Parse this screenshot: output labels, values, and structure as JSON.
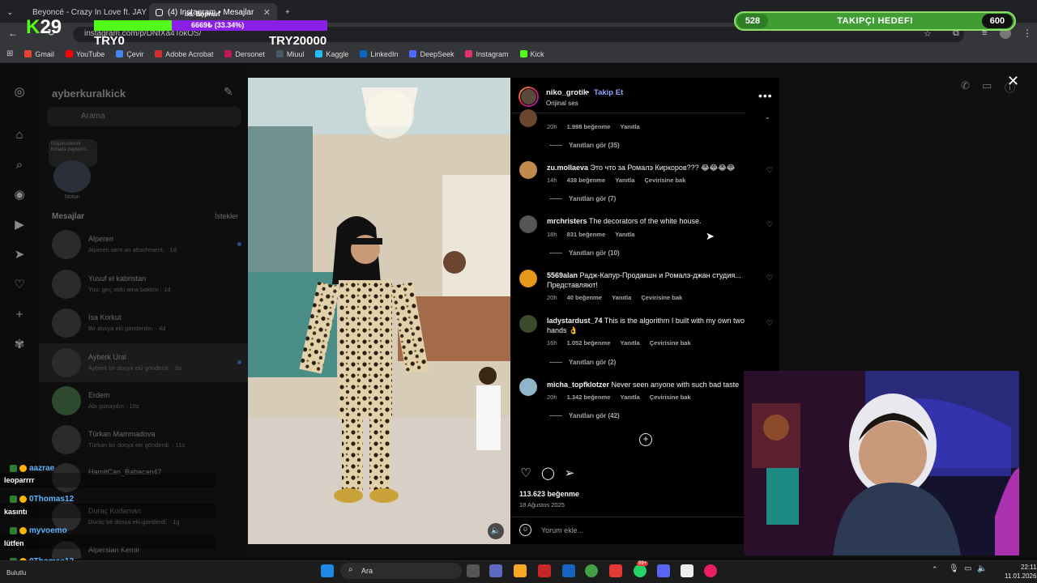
{
  "browser": {
    "tabs": [
      {
        "label": "Beyoncé - Crazy In Love ft. JAY",
        "active": false
      },
      {
        "label": "(4) Instagram • Mesajlar",
        "active": true
      }
    ],
    "url": "instagram.com/p/DNfXa4TokOS/",
    "bookmarks": [
      "Gmail",
      "YouTube",
      "Çevir",
      "Adobe Acrobat",
      "Dersonet",
      "Miuul",
      "Kaggle",
      "LinkedIn",
      "DeepSeek",
      "Instagram",
      "Kick"
    ]
  },
  "overlay": {
    "kick_logo": "29",
    "gift_goal_title": "ıxL Bo̦pnan",
    "gift_goal_progress_text": "6669₺ (33.34%)",
    "gift_goal_progress": 0.3334,
    "gift_left": "TRY0",
    "gift_right": "TRY20000",
    "follower_goal_label": "TAKIPÇI HEDEFI",
    "follower_current": "528",
    "follower_target": "600"
  },
  "dm": {
    "username": "ayberkuralkick",
    "search_placeholder": "Arama",
    "note_text": "Düşüncelerini burada paylaşın...",
    "note_label": "Notun",
    "messages_header": "Mesajlar",
    "requests_label": "İstekler",
    "conversations": [
      {
        "name": "Alperen",
        "preview": "Alperen sent an attachment. · 1d"
      },
      {
        "name": "Yusuf el kabristan",
        "preview": "You: geç oldu ama baktım · 1d"
      },
      {
        "name": "İsa Korkut",
        "preview": "Bir dosya eki gönderdin. · 4d"
      },
      {
        "name": "Ayberk Ural",
        "preview": "Ayberk bir dosya eki gönderdi. · 6s"
      },
      {
        "name": "Erdem",
        "preview": "Abi günaydın · 10s"
      },
      {
        "name": "Türkan Mammadova",
        "preview": "Türkan bir dosya eki gönderdi. · 11s"
      },
      {
        "name": "HamitCan_Babacan47",
        "preview": ""
      },
      {
        "name": "Duraç Kodaman",
        "preview": "Duraç bir dosya eki gönderdi. · 1g"
      },
      {
        "name": "Alperslan Kemir",
        "preview": ""
      }
    ]
  },
  "post": {
    "author": "niko_grotik",
    "separator": "•",
    "follow": "Takip Et",
    "audio": "Orijinal ses",
    "top_meta": {
      "time": "20h",
      "likes": "1.998 beğenme",
      "reply": "Yanıtla"
    },
    "top_replies": "Yanıtları gör (35)",
    "comments": [
      {
        "user": "zu.mollaeva",
        "text": "Это что за Ромалэ Киркоров??? 😂😂😂😂",
        "time": "14h",
        "likes": "438 beğenme",
        "reply": "Yanıtla",
        "translate": "Çevirisine bak",
        "replies": "Yanıtları gör (7)"
      },
      {
        "user": "mrchristers",
        "text": "The decorators of the white house.",
        "time": "18h",
        "likes": "831 beğenme",
        "reply": "Yanıtla",
        "translate": "",
        "replies": "Yanıtları gör (10)"
      },
      {
        "user": "5569alan",
        "text": "Радж-Капур-Продакшн и Ромалэ-джан студия... Представляют!",
        "time": "20h",
        "likes": "40 beğenme",
        "reply": "Yanıtla",
        "translate": "Çevirisine bak",
        "replies": ""
      },
      {
        "user": "ladystardust_74",
        "text": "This is the algorithm I built with my own two hands 👌",
        "time": "16h",
        "likes": "1.052 beğenme",
        "reply": "Yanıtla",
        "translate": "Çevirisine bak",
        "replies": "Yanıtları gör (2)"
      },
      {
        "user": "micha_topfklotzer",
        "text": "Never seen anyone with such bad taste",
        "time": "20h",
        "likes": "1.342 beğenme",
        "reply": "Yanıtla",
        "translate": "Çevirisine bak",
        "replies": "Yanıtları gör (42)"
      }
    ],
    "likes_total": "113.623 beğenme",
    "date": "18 Ağustos 2025",
    "comment_placeholder": "Yorum ekle..."
  },
  "chat": [
    {
      "user": "aazrae",
      "message": "leoparrrr"
    },
    {
      "user": "0Thomas12",
      "message": "kasıntı"
    },
    {
      "user": "myvoemo",
      "message": "lütfen"
    },
    {
      "user": "0Thomas12",
      "message": ""
    }
  ],
  "taskbar": {
    "weather": "Bulutlu",
    "search": "Ara",
    "time": "22:11",
    "date": "11.01.2026",
    "badge": "99+"
  },
  "colors": {
    "kick_green": "#53fc18",
    "ig_link": "#8fa8ff",
    "goal_green": "#3f9d34",
    "gift_purple": "#8a20e8"
  }
}
